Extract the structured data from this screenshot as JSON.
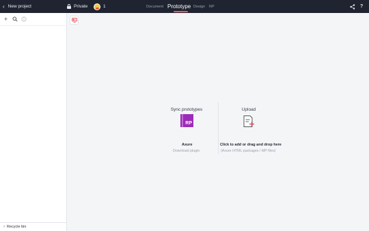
{
  "header": {
    "back_label": "New project",
    "privacy_label": "Private",
    "member_count": "1",
    "tabs": [
      "Document",
      "Prototype",
      "Design",
      "RP"
    ],
    "active_tab": "Prototype",
    "help_label": "?"
  },
  "sidebar": {
    "tools": [
      "add-icon",
      "search-icon",
      "info-icon"
    ],
    "recycle_label": "Recycle bin"
  },
  "main": {
    "sync": {
      "title": "Sync prototypes",
      "app_name": "Axure",
      "app_badge": "RP",
      "action": "Download plugin"
    },
    "upload": {
      "title": "Upload",
      "instruction": "Click to add or drag and drop here",
      "hint": "(Axure HTML packages / MP files)"
    }
  },
  "colors": {
    "topbar": "#1f2430",
    "accent": "#f2545b",
    "axure": "#9b2bb8"
  }
}
